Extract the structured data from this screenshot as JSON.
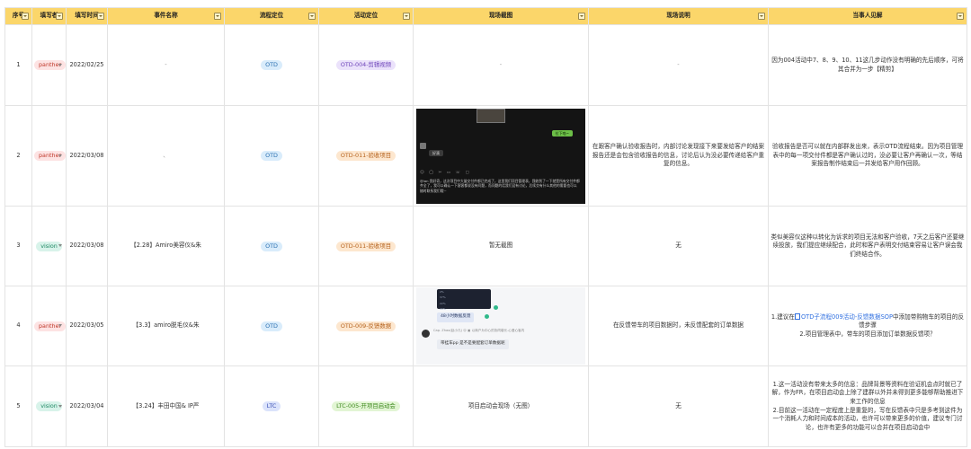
{
  "headers": [
    "序号",
    "填写者",
    "填写时间",
    "事件名称",
    "流程定位",
    "活动定位",
    "现场截图",
    "现场说明",
    "当事人见解"
  ],
  "rows": [
    {
      "no": "1",
      "author": "panther",
      "date": "2022/02/25",
      "event": "-",
      "process": "OTD",
      "activity": "OTD-004-剪辑视频",
      "screenshot_text": "-",
      "desc": "-",
      "insight": "因为004活动中7、8、9、10、11这几步动作没有明确的先后顺序，可将其合并为一步【精剪】"
    },
    {
      "no": "2",
      "author": "panther",
      "date": "2022/03/08",
      "event": "、",
      "process": "OTD",
      "activity": "OTD-011-验收项目",
      "desc": "在跟客户确认验收报告时，内部讨论发现接下来要发给客户的结案报告还是会包含验收报告的信息，讨论后认为没必要传递给客户重复的信息。",
      "insight": "验收报告是否可以就在内部群发出来，表示OTD流程结束。因为项目管理表中的每一项交付件都是客户确认过的，没必要让客户再确认一次，等结案报告制作结束后一并发给客户用作回顾。",
      "shot": {
        "green_bubble": "拉下咯~",
        "grey_bubble": "好滴",
        "toolbar": "☺ ◯ ✂ ▭ ☏ ▢",
        "message": "@ian 我好奇，这次项目中大量交付件都已完成了，这里我们项目管理表，我收到了一下就是所有交付件都齐全了，我可以确认一下客客都说没有问题，而问题的话我们没有讨论，后续交有什么其他的需要也可以随时联系我们哦~"
      }
    },
    {
      "no": "3",
      "author": "vision",
      "date": "2022/03/08",
      "event": "【2.28】Amiro美容仪&朱",
      "process": "OTD",
      "activity": "OTD-011-验收项目",
      "screenshot_text": "暂无截图",
      "desc": "无",
      "insight": "类似美容仪这种以转化为诉求的项目无法和客户验收，7天之后客户还要继续投放，我们提应继续配合，此时和客户表明交付结束容易让客户误会我们终结合作。"
    },
    {
      "no": "4",
      "author": "panther",
      "date": "2022/03/05",
      "event": "【3.3】amiro脱毛仪&朱",
      "process": "OTD",
      "activity": "OTD-009-反馈数据",
      "desc": "在反馈带车的项目数据时，未反馈配套的订单数据",
      "insight_line1_pre": "1.建议在",
      "insight_link": "OTD子流程009活动-反馈数据SOP",
      "insight_line1_post": "中添加带购物车的项目的反馈步骤",
      "insight_line2": "2.项目管理表中，带车的项目添加订单数据反馈项？",
      "shot": {
        "mini_table": [
          "2%",
          "37%",
          "22%",
          "20%"
        ],
        "bubble1": "48小时数据反馈",
        "name": "Cap. Zhao(赵小凡) ☺  ▣ 以商户为中心的协同增长-心爱心客内",
        "bubble2": "带挂车pp 是不是要配套订单数据呢"
      }
    },
    {
      "no": "5",
      "author": "vision",
      "date": "2022/03/04",
      "event": "【3.24】丰田中国& IP严",
      "process": "LTC",
      "activity": "LTC-005-开项目启动会",
      "screenshot_text": "项目启动会现场（无图）",
      "desc": "无",
      "insight": "1.这一活动没有带来太多的信息：品牌背景等资料在验证机会点时就已了解，作为FR，在项目启动会上除了建群以外并未得到更多能够帮助推进下来工作的信息\n2.目前这一活动在一定程度上是重复的，写在反馈表中只是多考到这件为一个消耗人力和时间成本的活动，也许可以带来更多的价值，建议专门讨论，也许有更多的功能可以合并在项目启动会中"
    }
  ]
}
